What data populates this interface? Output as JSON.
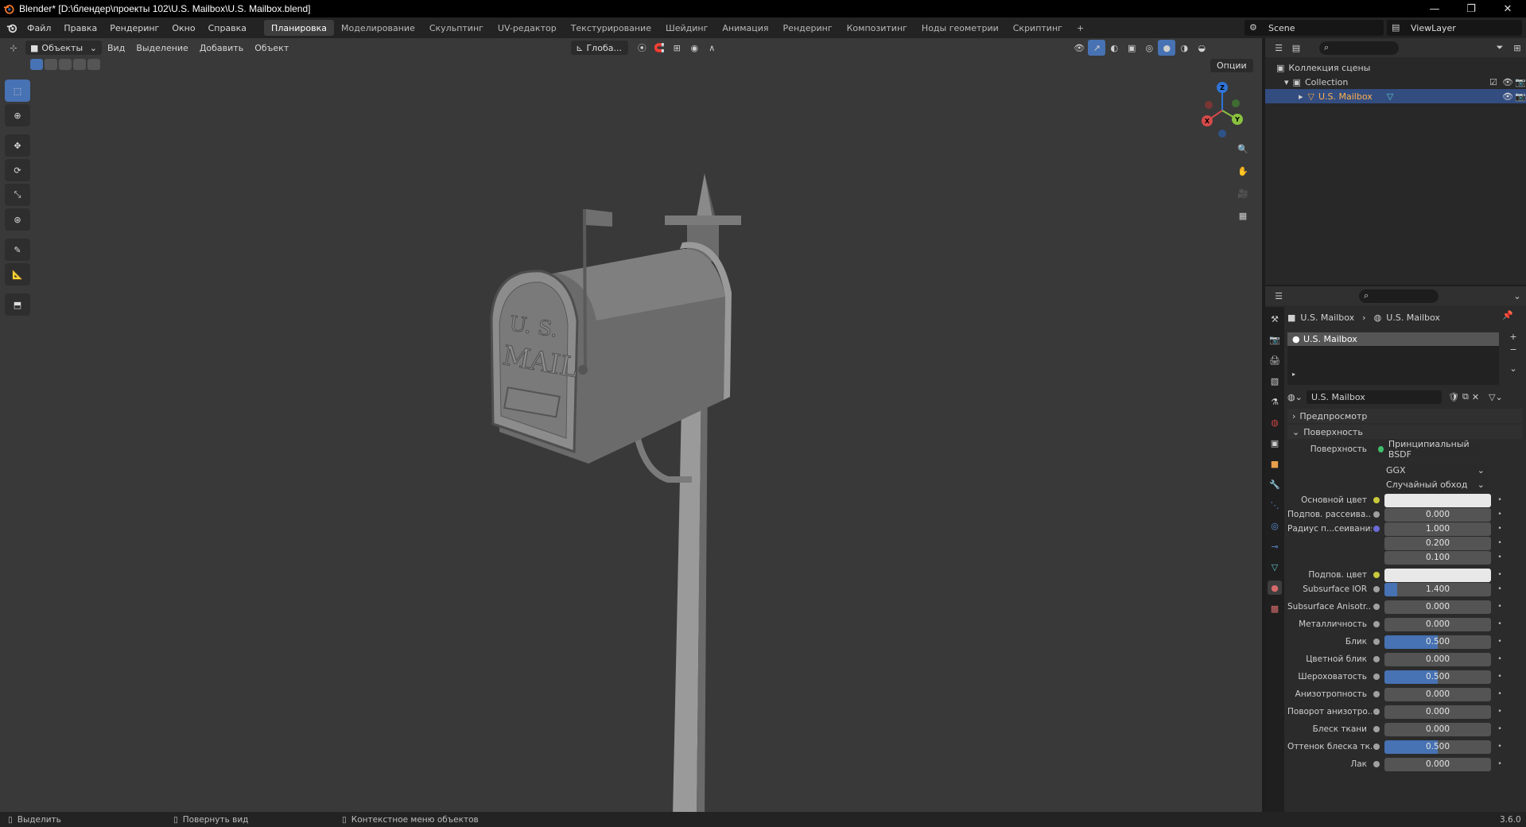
{
  "window": {
    "title": "Blender* [D:\\блендер\\проекты 102\\U.S. Mailbox\\U.S. Mailbox.blend]",
    "controls": [
      "—",
      "❐",
      "✕"
    ]
  },
  "menu": [
    "Файл",
    "Правка",
    "Рендеринг",
    "Окно",
    "Справка"
  ],
  "workspaces": [
    "Планировка",
    "Моделирование",
    "Скульптинг",
    "UV-редактор",
    "Текстурирование",
    "Шейдинг",
    "Анимация",
    "Рендеринг",
    "Композитинг",
    "Ноды геометрии",
    "Скриптинг"
  ],
  "active_workspace": "Планировка",
  "add_workspace": "+",
  "scene": "Scene",
  "view_layer": "ViewLayer",
  "viewport": {
    "mode": "Объекты",
    "menus": [
      "Вид",
      "Выделение",
      "Добавить",
      "Объект"
    ],
    "orientation": "Глоба...",
    "options": "Опции",
    "gizmo_axes": {
      "x": "X",
      "y": "Y",
      "z": "Z"
    },
    "mailbox_text_line1": "U. S.",
    "mailbox_text_line2": "MAIL"
  },
  "outliner": {
    "root": "Коллекция сцены",
    "collection": "Collection",
    "object": "U.S. Mailbox"
  },
  "properties": {
    "breadcrumb_object": "U.S. Mailbox",
    "breadcrumb_material": "U.S. Mailbox",
    "slot": "U.S. Mailbox",
    "material_name": "U.S. Mailbox",
    "panel_preview": "Предпросмотр",
    "panel_surface": "Поверхность",
    "surface_label": "Поверхность",
    "surface_value": "Принципиальный BSDF",
    "distribution": "GGX",
    "subsurface_method": "Случайный обход",
    "rows": [
      {
        "label": "Основной цвет",
        "value": "",
        "type": "color",
        "dot": "#c8c83c"
      },
      {
        "label": "Подпов. рассеива...",
        "value": "0.000",
        "type": "num",
        "fill": 0,
        "dot": "#a0a0a0"
      },
      {
        "label": "Радиус п...сеивания",
        "value": "1.000",
        "type": "num",
        "fill": 0,
        "dot": "#6b6bd6"
      },
      {
        "label": "",
        "value": "0.200",
        "type": "num",
        "fill": 0,
        "dot": ""
      },
      {
        "label": "",
        "value": "0.100",
        "type": "num",
        "fill": 0,
        "dot": ""
      },
      {
        "label": "Подпов. цвет",
        "value": "",
        "type": "color",
        "dot": "#c8c83c"
      },
      {
        "label": "Subsurface IOR",
        "value": "1.400",
        "type": "num",
        "fill": 0.12,
        "dot": "#a0a0a0"
      },
      {
        "label": "Subsurface Anisotr...",
        "value": "0.000",
        "type": "num",
        "fill": 0,
        "dot": "#a0a0a0"
      },
      {
        "label": "Металличность",
        "value": "0.000",
        "type": "num",
        "fill": 0,
        "dot": "#a0a0a0"
      },
      {
        "label": "Блик",
        "value": "0.500",
        "type": "num",
        "fill": 0.5,
        "dot": "#a0a0a0"
      },
      {
        "label": "Цветной блик",
        "value": "0.000",
        "type": "num",
        "fill": 0,
        "dot": "#a0a0a0"
      },
      {
        "label": "Шероховатость",
        "value": "0.500",
        "type": "num",
        "fill": 0.5,
        "dot": "#a0a0a0"
      },
      {
        "label": "Анизотропность",
        "value": "0.000",
        "type": "num",
        "fill": 0,
        "dot": "#a0a0a0"
      },
      {
        "label": "Поворот анизотро...",
        "value": "0.000",
        "type": "num",
        "fill": 0,
        "dot": "#a0a0a0"
      },
      {
        "label": "Блеск ткани",
        "value": "0.000",
        "type": "num",
        "fill": 0,
        "dot": "#a0a0a0"
      },
      {
        "label": "Оттенок блеска тк...",
        "value": "0.500",
        "type": "num",
        "fill": 0.5,
        "dot": "#a0a0a0"
      },
      {
        "label": "Лак",
        "value": "0.000",
        "type": "num",
        "fill": 0,
        "dot": "#a0a0a0"
      }
    ]
  },
  "status": {
    "select": "Выделить",
    "rotate": "Повернуть вид",
    "context": "Контекстное меню объектов",
    "version": "3.6.0"
  },
  "colors": {
    "accent": "#4772b3",
    "selected_row": "#334d80",
    "selected_text": "#ffb14c",
    "viewport_bg": "#393939"
  }
}
